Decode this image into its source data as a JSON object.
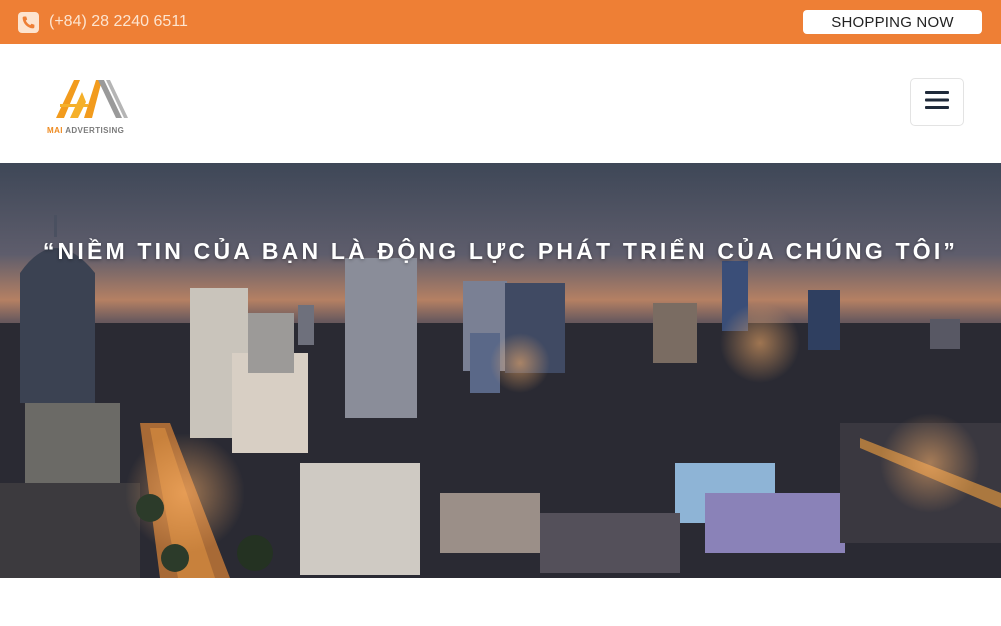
{
  "topbar": {
    "phone_icon": "phone-icon",
    "phone": "(+84) 28 2240 6511",
    "shop_button": "SHOPPING NOW",
    "color": "#ee7f35"
  },
  "header": {
    "logo_brand": "MAI",
    "logo_tagline": "ADVERTISING",
    "menu_icon": "hamburger-menu-icon"
  },
  "hero": {
    "quote": "“NIỀM TIN CỦA BẠN LÀ ĐỘNG LỰC PHÁT TRIỂN CỦA CHÚNG TÔI”"
  }
}
